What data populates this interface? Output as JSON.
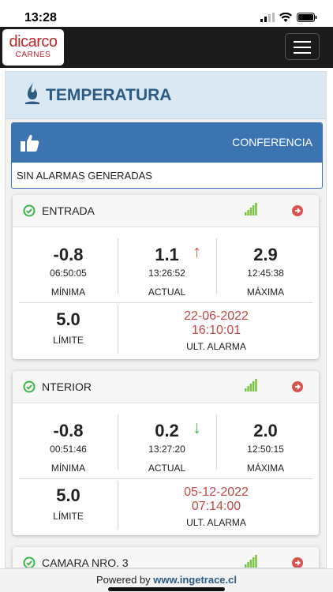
{
  "status": {
    "time": "13:28"
  },
  "brand": {
    "name": "dicarco",
    "sub": "CARNES"
  },
  "section": {
    "title": "TEMPERATURA"
  },
  "conference": {
    "header": "CONFERENCIA",
    "message": "SIN ALARMAS GENERADAS"
  },
  "cards": [
    {
      "name": "ENTRADA",
      "min": {
        "value": "-0.8",
        "time": "06:50:05",
        "label": "MÍNIMA"
      },
      "current": {
        "value": "1.1",
        "time": "13:26:52",
        "label": "ACTUAL",
        "arrow": "↑"
      },
      "max": {
        "value": "2.9",
        "time": "12:45:38",
        "label": "MÁXIMA"
      },
      "limit": {
        "value": "5.0",
        "label": "LÍMITE"
      },
      "last_alarm": {
        "date": "22-06-2022",
        "time": "16:10:01",
        "label": "ULT. ALARMA"
      }
    },
    {
      "name": "NTERIOR",
      "min": {
        "value": "-0.8",
        "time": "00:51:46",
        "label": "MÍNIMA"
      },
      "current": {
        "value": "0.2",
        "time": "13:27:20",
        "label": "ACTUAL",
        "arrow": "↓"
      },
      "max": {
        "value": "2.0",
        "time": "12:50:15",
        "label": "MÁXIMA"
      },
      "limit": {
        "value": "5.0",
        "label": "LÍMITE"
      },
      "last_alarm": {
        "date": "05-12-2022",
        "time": "07:14:00",
        "label": "ULT. ALARMA"
      }
    },
    {
      "name": "CAMARA NRO. 3"
    }
  ],
  "footer": {
    "prefix": "Powered by",
    "link": "www.ingetrace.cl"
  },
  "colors": {
    "accent": "#3b74b0",
    "title": "#2d5b81",
    "alarm": "#c24a45",
    "ok": "#3cb54a",
    "up": "#d9534f",
    "down": "#3cb54a"
  },
  "icons": [
    "flame-icon",
    "thumbs-up-icon",
    "check-circle-icon",
    "signal-icon",
    "arrow-circle-right-icon",
    "hamburger-menu-icon"
  ]
}
